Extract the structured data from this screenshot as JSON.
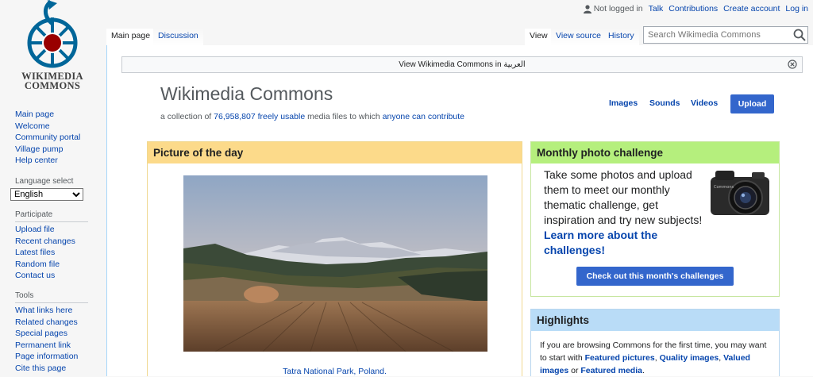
{
  "logo": {
    "line1": "WIKIMEDIA",
    "line2": "COMMONS"
  },
  "sidebar": {
    "navigation": [
      {
        "label": "Main page"
      },
      {
        "label": "Welcome"
      },
      {
        "label": "Community portal"
      },
      {
        "label": "Village pump"
      },
      {
        "label": "Help center"
      }
    ],
    "language_heading": "Language select",
    "language_selected": "English",
    "participate_heading": "Participate",
    "participate": [
      {
        "label": "Upload file"
      },
      {
        "label": "Recent changes"
      },
      {
        "label": "Latest files"
      },
      {
        "label": "Random file"
      },
      {
        "label": "Contact us"
      }
    ],
    "tools_heading": "Tools",
    "tools": [
      {
        "label": "What links here"
      },
      {
        "label": "Related changes"
      },
      {
        "label": "Special pages"
      },
      {
        "label": "Permanent link"
      },
      {
        "label": "Page information"
      },
      {
        "label": "Cite this page"
      }
    ]
  },
  "personal": {
    "not_logged_in": "Not logged in",
    "talk": "Talk",
    "contributions": "Contributions",
    "create_account": "Create account",
    "login": "Log in"
  },
  "tabs": {
    "main_page": "Main page",
    "discussion": "Discussion",
    "view": "View",
    "view_source": "View source",
    "history": "History"
  },
  "search": {
    "placeholder": "Search Wikimedia Commons"
  },
  "banner": {
    "text": "View Wikimedia Commons in العربية"
  },
  "header": {
    "title": "Wikimedia Commons",
    "tagline_prefix": "a collection of",
    "file_count": "76,958,807",
    "freely_usable": "freely usable",
    "tagline_middle": "media files to which",
    "anyone_can_contribute": "anyone can contribute"
  },
  "media_links": {
    "images": "Images",
    "sounds": "Sounds",
    "videos": "Videos",
    "upload": "Upload"
  },
  "potd": {
    "title": "Picture of the day",
    "caption": "Tatra National Park, Poland."
  },
  "challenge": {
    "title": "Monthly photo challenge",
    "text": "Take some photos and upload them to meet our monthly thematic challenge, get inspiration and try new subjects!",
    "link": "Learn more about the challenges!",
    "button": "Check out this month's challenges"
  },
  "highlights": {
    "title": "Highlights",
    "text_prefix": "If you are browsing Commons for the first time, you may want to start with",
    "featured_pictures": "Featured pictures",
    "quality_images": "Quality images",
    "valued_images": "Valued images",
    "or": "or",
    "featured_media": "Featured media"
  },
  "colors": {
    "link": "#0645ad",
    "button": "#3366cc",
    "potd_header": "#fcda8a",
    "challenge_header": "#b5ef7d",
    "highlights_header": "#b9dcf7"
  }
}
